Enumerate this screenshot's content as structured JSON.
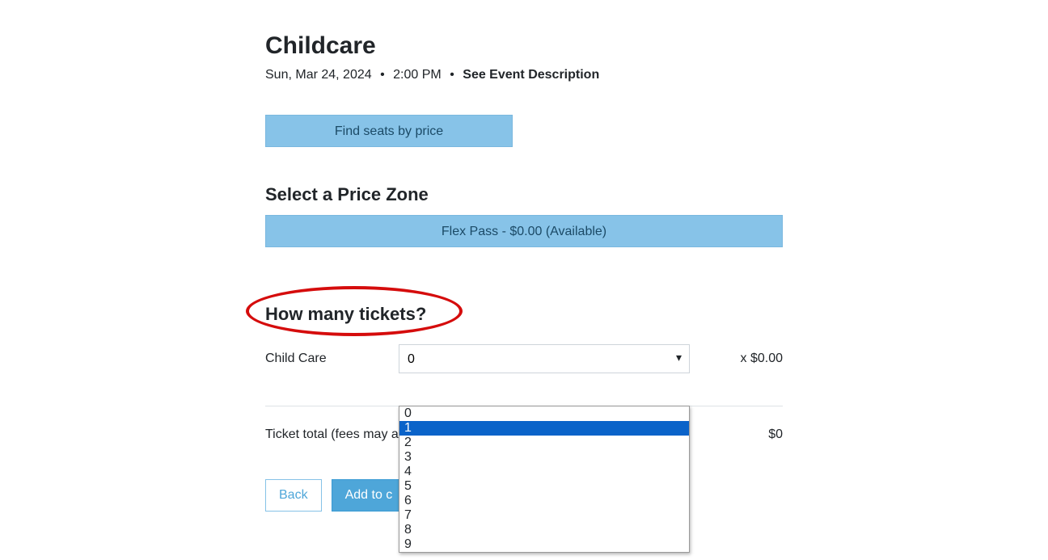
{
  "event": {
    "title": "Childcare",
    "date": "Sun, Mar 24, 2024",
    "time": "2:00 PM",
    "desc_link_label": "See Event Description"
  },
  "find_seats_label": "Find seats by price",
  "price_zone": {
    "heading": "Select a Price Zone",
    "option_label": "Flex Pass - $0.00 (Available)"
  },
  "ticket_section": {
    "heading": "How many tickets?",
    "row_label": "Child Care",
    "selected_qty": "0",
    "price_text": "x $0.00",
    "options": [
      "0",
      "1",
      "2",
      "3",
      "4",
      "5",
      "6",
      "7",
      "8",
      "9"
    ],
    "highlighted_index": 1
  },
  "total": {
    "label": "Ticket total (fees may a",
    "value": "$0"
  },
  "buttons": {
    "back": "Back",
    "add_to_cart": "Add to c"
  }
}
